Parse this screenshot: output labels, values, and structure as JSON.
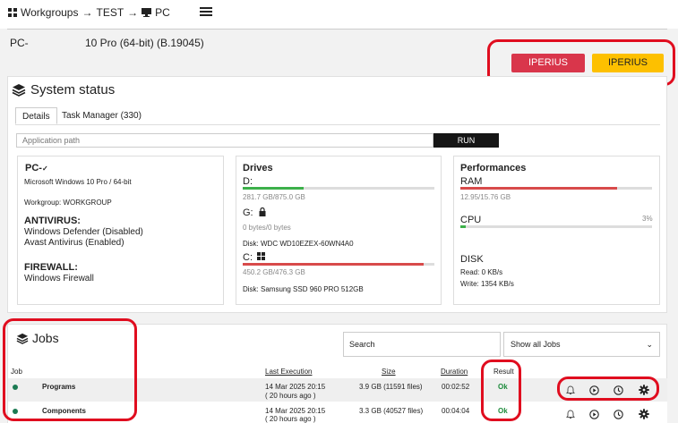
{
  "breadcrumb": {
    "root": "Workgroups",
    "group": "TEST",
    "pc": "PC",
    "sep": "→"
  },
  "pc_header": {
    "id": "PC-",
    "os": "10 Pro (64-bit) (B.19045)"
  },
  "buttons": {
    "remote": "IPERIUS REMOTE",
    "backup": "IPERIUS BACKUP"
  },
  "colors": {
    "remote": "#d9364b",
    "backup": "#fdc000",
    "ok": "#1b8a3a",
    "ram_bar": "#d84a4a",
    "drive_d_bar": "#3db04a"
  },
  "system_status": {
    "title": "System status",
    "tabs": {
      "details": "Details",
      "task_manager": "Task Manager (330)"
    },
    "app_path_placeholder": "Application path",
    "run_label": "RUN"
  },
  "pc_info": {
    "name": "PC-",
    "os": "Microsoft Windows 10 Pro / 64-bit",
    "workgroup": "Workgroup: WORKGROUP",
    "antivirus_title": "ANTIVIRUS:",
    "antivirus": [
      "Windows Defender (Disabled)",
      "Avast Antivirus (Enabled)"
    ],
    "firewall_title": "FIREWALL:",
    "firewall": "Windows Firewall"
  },
  "drives": {
    "title": "Drives",
    "items": [
      {
        "letter": "D:",
        "usage": "281.7 GB/875.0 GB",
        "fill": 0.32
      },
      {
        "letter": "G:",
        "usage": "0 bytes/0 bytes",
        "disk": "Disk: WDC WD10EZEX-60WN4A0",
        "fill": 0
      },
      {
        "letter": "C:",
        "usage": "450.2 GB/476.3 GB",
        "disk": "Disk: Samsung SSD 960 PRO 512GB",
        "fill": 0.945
      }
    ]
  },
  "performances": {
    "title": "Performances",
    "ram_label": "RAM",
    "ram_usage": "12.95/15.76 GB",
    "ram_fill": 0.82,
    "cpu_label": "CPU",
    "cpu_percent": "3%",
    "cpu_fill": 0.03,
    "disk_label": "DISK",
    "disk_read": "Read: 0 KB/s",
    "disk_write": "Write: 1354 KB/s"
  },
  "jobs": {
    "title": "Jobs",
    "search_placeholder": "Search",
    "filter": "Show all Jobs",
    "headers": {
      "job": "Job",
      "last": "Last Execution",
      "size": "Size",
      "duration": "Duration",
      "result": "Result"
    },
    "rows": [
      {
        "name": "Programs",
        "last_date": "14 Mar 2025 20:15",
        "last_ago": "( 20 hours ago )",
        "size": "3.9 GB (11591 files)",
        "duration": "00:02:52",
        "result": "Ok"
      },
      {
        "name": "Components",
        "last_date": "14 Mar 2025 20:15",
        "last_ago": "( 20 hours ago )",
        "size": "3.3 GB (40527 files)",
        "duration": "00:04:04",
        "result": "Ok"
      }
    ]
  }
}
